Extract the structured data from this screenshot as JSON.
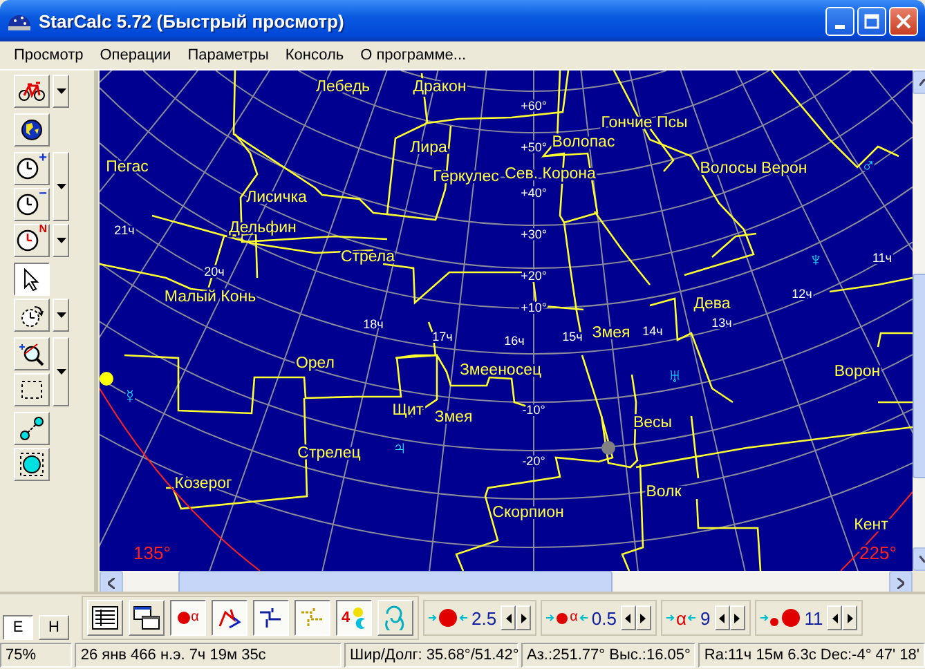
{
  "window": {
    "title": "StarCalc 5.72 (Быстрый просмотр)"
  },
  "menu": [
    {
      "label": "Просмотр"
    },
    {
      "label": "Операции"
    },
    {
      "label": "Параметры"
    },
    {
      "label": "Консоль"
    },
    {
      "label": "О программе..."
    }
  ],
  "left_toolbar": [
    {
      "kind": "bicycle",
      "selected": false,
      "dropdown": true
    },
    {
      "kind": "globe",
      "selected": false,
      "dropdown": false
    },
    {
      "kind": "clock",
      "symbol": "+",
      "selected": false,
      "dropdown": true
    },
    {
      "kind": "clock",
      "symbol": "−",
      "selected": false,
      "dropdown": false
    },
    {
      "kind": "clock",
      "symbol": "N",
      "selected": false,
      "dropdown": true
    },
    {
      "kind": "pointer",
      "selected": true,
      "dropdown": false
    },
    {
      "kind": "rotate",
      "selected": false,
      "dropdown": true
    },
    {
      "kind": "zoom",
      "selected": false,
      "dropdown": true
    },
    {
      "kind": "frame",
      "selected": false,
      "dropdown": false
    },
    {
      "kind": "ruler",
      "selected": false,
      "dropdown": false
    },
    {
      "kind": "circle",
      "selected": false,
      "dropdown": false
    }
  ],
  "sky_map": {
    "labels": [
      {
        "text": "Лебедь",
        "kind": "constellation"
      },
      {
        "text": "Дракон",
        "kind": "constellation"
      },
      {
        "text": "+60°",
        "kind": "grid"
      },
      {
        "text": "Гончие Псы",
        "kind": "constellation"
      },
      {
        "text": "Лира",
        "kind": "constellation"
      },
      {
        "text": "+50°",
        "kind": "grid"
      },
      {
        "text": "Волопас",
        "kind": "constellation"
      },
      {
        "text": "Пегас",
        "kind": "constellation"
      },
      {
        "text": "Геркулес",
        "kind": "constellation"
      },
      {
        "text": "Сев. Корона",
        "kind": "constellation"
      },
      {
        "text": "Волосы Верон",
        "kind": "constellation"
      },
      {
        "text": "♂",
        "kind": "planet"
      },
      {
        "text": "+40°",
        "kind": "grid"
      },
      {
        "text": "Лисичка",
        "kind": "constellation"
      },
      {
        "text": "21ч",
        "kind": "grid"
      },
      {
        "text": "Дельфин",
        "kind": "constellation"
      },
      {
        "text": "+30°",
        "kind": "grid"
      },
      {
        "text": "Стрела",
        "kind": "constellation"
      },
      {
        "text": "♆",
        "kind": "planet"
      },
      {
        "text": "11ч",
        "kind": "grid"
      },
      {
        "text": "20ч",
        "kind": "grid"
      },
      {
        "text": "+20°",
        "kind": "grid"
      },
      {
        "text": "Малый Конь",
        "kind": "constellation"
      },
      {
        "text": "+10°",
        "kind": "grid"
      },
      {
        "text": "Дева",
        "kind": "constellation"
      },
      {
        "text": "12ч",
        "kind": "grid"
      },
      {
        "text": "18ч",
        "kind": "grid"
      },
      {
        "text": "17ч",
        "kind": "grid"
      },
      {
        "text": "16ч",
        "kind": "grid"
      },
      {
        "text": "15ч",
        "kind": "grid"
      },
      {
        "text": "Змея",
        "kind": "constellation"
      },
      {
        "text": "14ч",
        "kind": "grid"
      },
      {
        "text": "13ч",
        "kind": "grid"
      },
      {
        "text": "Орел",
        "kind": "constellation"
      },
      {
        "text": "Змееносец",
        "kind": "constellation"
      },
      {
        "text": "♅",
        "kind": "planet"
      },
      {
        "text": "Ворон",
        "kind": "constellation"
      },
      {
        "text": "☿",
        "kind": "planet"
      },
      {
        "text": "Щит",
        "kind": "constellation"
      },
      {
        "text": "Змея",
        "kind": "constellation"
      },
      {
        "text": "-10°",
        "kind": "grid"
      },
      {
        "text": "Весы",
        "kind": "constellation"
      },
      {
        "text": "Стрелец",
        "kind": "constellation"
      },
      {
        "text": "♃",
        "kind": "planet"
      },
      {
        "text": "-20°",
        "kind": "grid"
      },
      {
        "text": "Козерог",
        "kind": "constellation"
      },
      {
        "text": "Волк",
        "kind": "constellation"
      },
      {
        "text": "Скорпион",
        "kind": "constellation"
      },
      {
        "text": "Кент",
        "kind": "constellation"
      },
      {
        "text": "135°",
        "kind": "horizon"
      },
      {
        "text": "225°",
        "kind": "horizon"
      }
    ]
  },
  "bottom_toolbar": {
    "direction_buttons": [
      {
        "label": "E",
        "selected": true
      },
      {
        "label": "H",
        "selected": false
      }
    ],
    "tools": [
      {
        "kind": "table",
        "on": false
      },
      {
        "kind": "windows",
        "on": false
      },
      {
        "kind": "star-alpha",
        "symbol": "α",
        "on": true
      },
      {
        "kind": "zigzag",
        "on": true
      },
      {
        "kind": "lines",
        "on": true
      },
      {
        "kind": "dashes",
        "on": true
      },
      {
        "kind": "planets",
        "symbol": "4",
        "on": true
      },
      {
        "kind": "swirl",
        "on": false
      }
    ],
    "steppers": [
      {
        "kind": "star-size",
        "value": "2.5"
      },
      {
        "kind": "star-alpha",
        "symbol": "α",
        "value": "0.5"
      },
      {
        "kind": "alpha",
        "symbol": "α",
        "value": "9"
      },
      {
        "kind": "dots",
        "value": "11"
      }
    ]
  },
  "status_bar": [
    "75%",
    "26 янв 466 н.э. 7ч 19м 35с",
    "Шир/Долг: 35.68°/51.42°",
    "Аз.:251.77° Выс.:16.05°",
    "Ra:11ч 15м 6.3с Dec:-4° 47' 18'"
  ]
}
